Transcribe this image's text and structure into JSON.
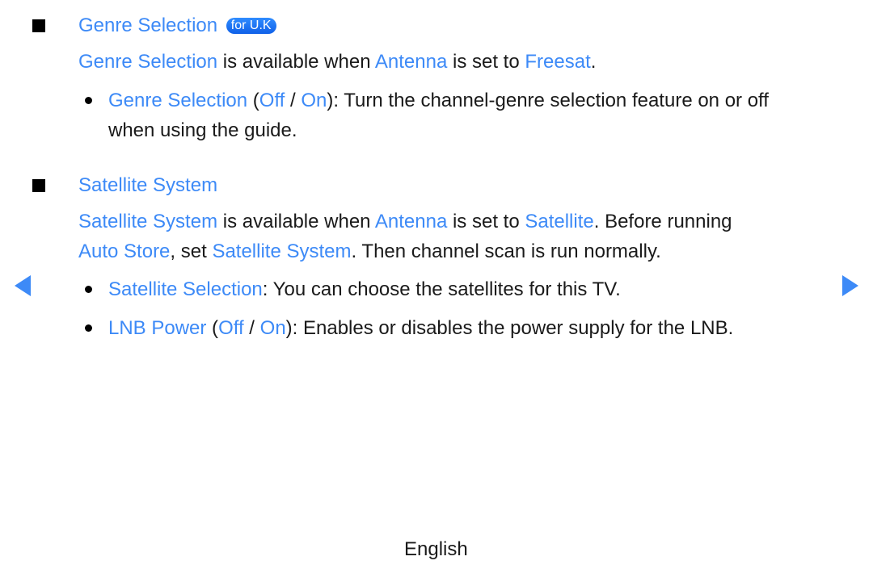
{
  "sections": [
    {
      "title": "Genre Selection",
      "badge": "for U.K",
      "para": {
        "t1": "Genre Selection",
        "t2": " is available when ",
        "t3": "Antenna",
        "t4": " is set to ",
        "t5": "Freesat",
        "t6": "."
      },
      "bullets": [
        {
          "name": "Genre Selection",
          "open": " (",
          "off": "Off",
          "sep": " / ",
          "on": "On",
          "rest": "): Turn the channel-genre selection feature on or off",
          "line2": "when using the guide."
        }
      ]
    },
    {
      "title": "Satellite System",
      "para": {
        "t1": "Satellite System",
        "t2": " is available when ",
        "t3": "Antenna",
        "t4": " is set to ",
        "t5": "Satellite",
        "t6": ". Before running",
        "l2a": "Auto Store",
        "l2b": ", set ",
        "l2c": "Satellite System",
        "l2d": ". Then channel scan is run normally."
      },
      "bullets": [
        {
          "name": "Satellite Selection",
          "rest": ": You can choose the satellites for this TV."
        },
        {
          "name": "LNB Power",
          "open": " (",
          "off": "Off",
          "sep": " / ",
          "on": "On",
          "rest": "): Enables or disables the power supply for the LNB."
        }
      ]
    }
  ],
  "nav": {
    "prev": "previous-page",
    "next": "next-page"
  },
  "footer": {
    "language": "English"
  },
  "colors": {
    "accent": "#3d8af7",
    "text": "#1a1a1a"
  }
}
